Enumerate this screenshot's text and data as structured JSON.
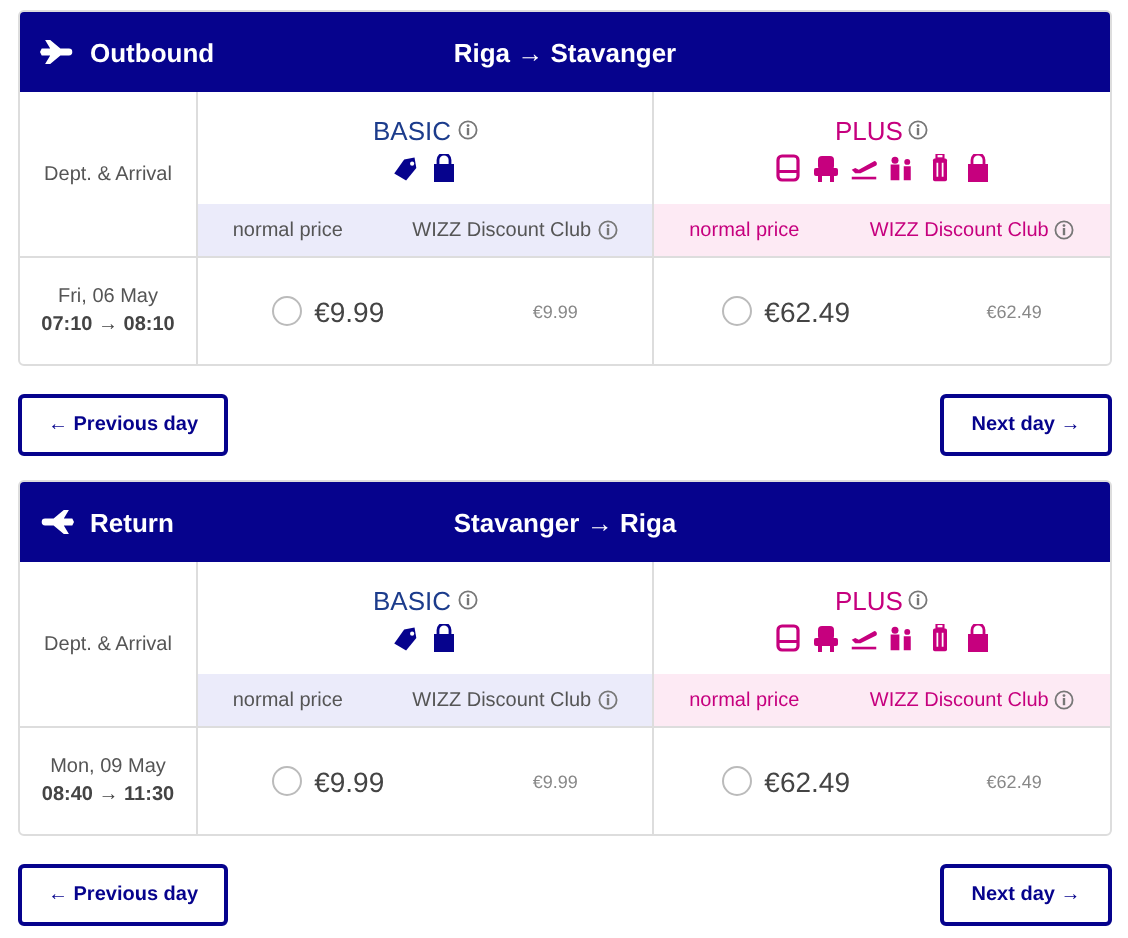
{
  "sections": [
    {
      "kind": "outbound",
      "label": "Outbound",
      "route": "Riga → Stavanger",
      "dept_label": "Dept. & Arrival",
      "date": "Fri, 06 May",
      "times": "07:10 → 08:10",
      "fares": [
        {
          "kind": "basic",
          "name": "BASIC",
          "normal_label": "normal price",
          "club_label": "WIZZ Discount Club",
          "price": "€9.99",
          "club_price": "€9.99",
          "selected": false
        },
        {
          "kind": "plus",
          "name": "PLUS",
          "normal_label": "normal price",
          "club_label": "WIZZ Discount Club",
          "price": "€62.49",
          "club_price": "€62.49",
          "selected": false
        }
      ],
      "prev": "← Previous day",
      "next": "Next day →"
    },
    {
      "kind": "return",
      "label": "Return",
      "route": "Stavanger → Riga",
      "dept_label": "Dept. & Arrival",
      "date": "Mon, 09 May",
      "times": "08:40 → 11:30",
      "fares": [
        {
          "kind": "basic",
          "name": "BASIC",
          "normal_label": "normal price",
          "club_label": "WIZZ Discount Club",
          "price": "€9.99",
          "club_price": "€9.99",
          "selected": false
        },
        {
          "kind": "plus",
          "name": "PLUS",
          "normal_label": "normal price",
          "club_label": "WIZZ Discount Club",
          "price": "€62.49",
          "club_price": "€62.49",
          "selected": false
        }
      ],
      "prev": "← Previous day",
      "next": "Next day →"
    }
  ]
}
